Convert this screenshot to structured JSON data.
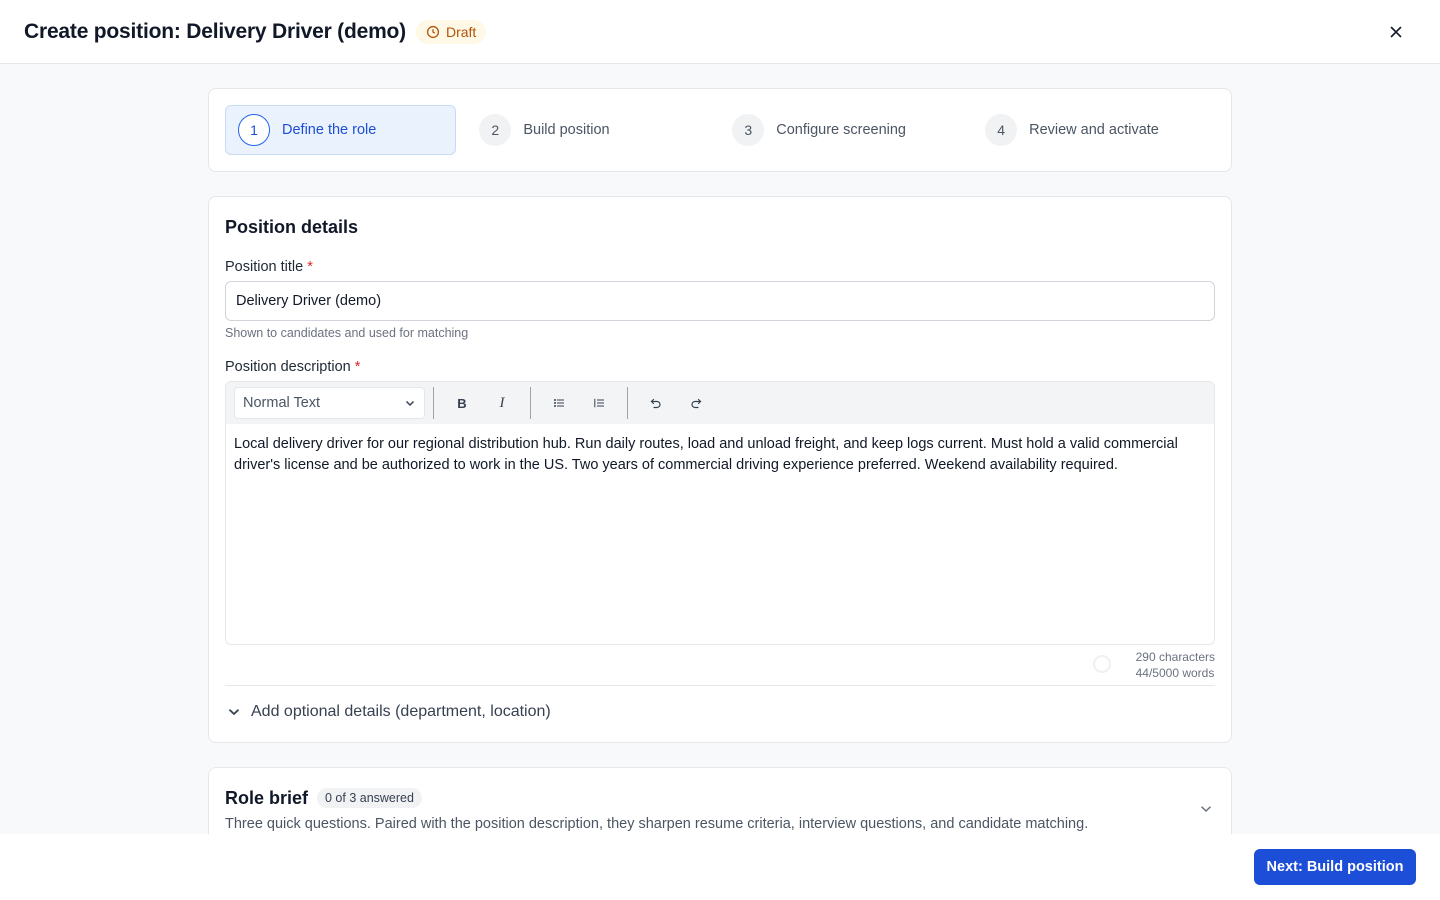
{
  "header": {
    "title": "Create position: Delivery Driver (demo)",
    "status_badge": "Draft",
    "close_icon": "close-icon"
  },
  "stepper": {
    "steps": [
      {
        "number": "1",
        "label": "Define the role",
        "active": true
      },
      {
        "number": "2",
        "label": "Build position",
        "active": false
      },
      {
        "number": "3",
        "label": "Configure screening",
        "active": false
      },
      {
        "number": "4",
        "label": "Review and activate",
        "active": false
      }
    ]
  },
  "position_details": {
    "heading": "Position details",
    "title_label": "Position title",
    "title_value": "Delivery Driver (demo)",
    "title_hint": "Shown to candidates and used for matching",
    "description_label": "Position description",
    "required_marker": "*",
    "editor": {
      "format_select": "Normal Text",
      "bold_label": "B",
      "italic_label": "I",
      "body": "Local delivery driver for our regional distribution hub. Run daily routes, load and unload freight, and keep logs current. Must hold a valid commercial driver's license and be authorized to work in the US. Two years of commercial driving experience preferred. Weekend availability required."
    },
    "char_count": "290 characters",
    "word_count": "44/5000 words",
    "optional_toggle": "Add optional details (department, location)"
  },
  "role_brief": {
    "heading": "Role brief",
    "answered_badge": "0 of 3 answered",
    "description": "Three quick questions. Paired with the position description, they sharpen resume criteria, interview questions, and candidate matching."
  },
  "footer": {
    "next_button": "Next: Build position"
  },
  "colors": {
    "primary": "#1d4ed8",
    "draft_badge_bg": "#fef9e7",
    "draft_badge_text": "#b45309",
    "required": "#dc2626"
  }
}
